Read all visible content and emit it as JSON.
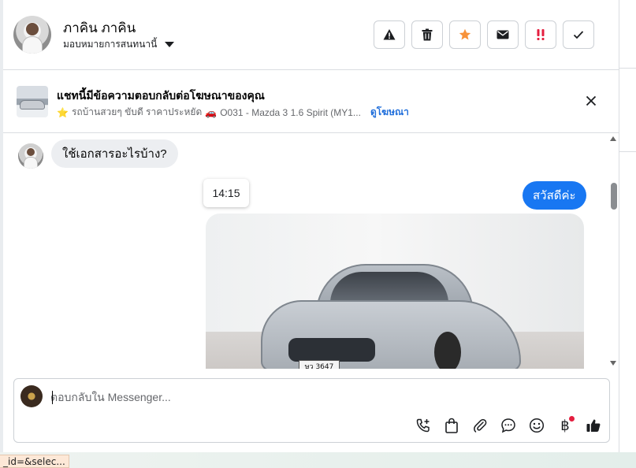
{
  "header": {
    "contact_name": "ภาคิน ภาคิน",
    "assign_label": "มอบหมายการสนทนานี้",
    "tools": [
      {
        "name": "spam-icon",
        "label": "!"
      },
      {
        "name": "trash-icon",
        "label": ""
      },
      {
        "name": "star-icon",
        "label": "★"
      },
      {
        "name": "mail-icon",
        "label": ""
      },
      {
        "name": "follow-up-icon",
        "label": "!!"
      },
      {
        "name": "check-icon",
        "label": "✓"
      }
    ],
    "star_color": "#f7923a",
    "follow_up_color": "#e41e3f"
  },
  "ad_banner": {
    "title": "แชทนี้มีข้อความตอบกลับต่อโฆษณาของคุณ",
    "star": "⭐",
    "subtitle_part1": "รถบ้านสวยๆ ขับดี ราคาประหยัด",
    "car_emoji": "🚗",
    "subtitle_part2": "O031 - Mazda 3 1.6 Spirit (MY1...",
    "link_label": "ดูโฆษณา"
  },
  "chat": {
    "incoming_message": "ใช้เอกสารอะไรบ้าง?",
    "outgoing_message": "สวัสดีค่ะ",
    "time_tooltip": "14:15",
    "photo_plate": "ษว 3647",
    "outgoing_color": "#1877f2"
  },
  "composer": {
    "placeholder": "ตอบกลับใน Messenger...",
    "currency_symbol": "฿"
  },
  "status_bar": {
    "url_text": "_id=&selec..."
  }
}
